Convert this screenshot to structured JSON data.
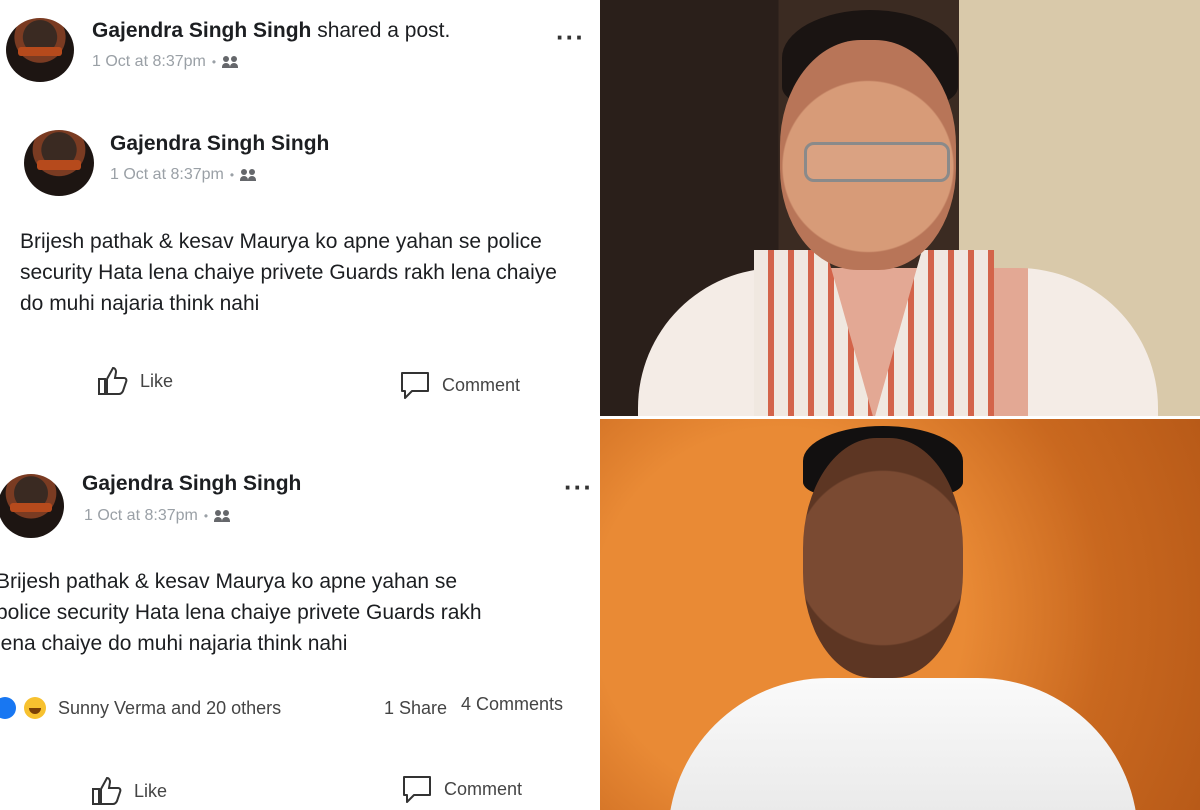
{
  "shared_post": {
    "author": "Gajendra Singh Singh",
    "action": "shared a post.",
    "time": "1 Oct at 8:37pm",
    "audience_icon": "friends-icon",
    "inner": {
      "author": "Gajendra Singh Singh",
      "time": "1 Oct at 8:37pm",
      "audience_icon": "friends-icon",
      "text": "Brijesh pathak & kesav Maurya ko apne yahan se police security Hata lena chaiye privete Guards rakh lena chaiye do muhi najaria think nahi"
    },
    "actions": {
      "like": "Like",
      "comment": "Comment"
    }
  },
  "post": {
    "author": "Gajendra Singh Singh",
    "time": "1 Oct at 8:37pm",
    "audience_icon": "friends-icon",
    "text_lines": [
      "Brijesh pathak & kesav Maurya ko apne yahan se",
      "police security Hata lena chaiye privete Guards rakh",
      "lena chaiye do muhi najaria think nahi"
    ],
    "reactions_text": "Sunny Verma and 20 others",
    "shares": "1 Share",
    "comments": "4 Comments",
    "actions": {
      "like": "Like",
      "comment": "Comment"
    }
  },
  "colors": {
    "like_blue": "#1877f2",
    "haha_yellow": "#f7c12f",
    "meta_gray": "#9aa0a6"
  }
}
